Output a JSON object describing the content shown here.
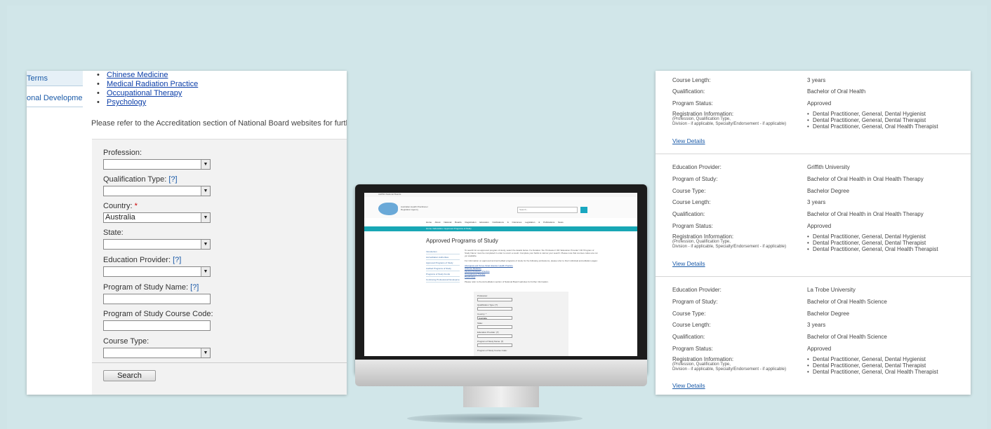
{
  "left_panel": {
    "sidebar": [
      "Terms",
      "onal Development"
    ],
    "profession_links": [
      "Chinese Medicine",
      "Medical Radiation Practice",
      "Occupational Therapy",
      "Psychology"
    ],
    "note": "Please refer to the Accreditation section of National Board websites for further info",
    "form": {
      "profession": "Profession:",
      "qualification_type": "Qualification Type:",
      "help": "[?]",
      "country": "Country:",
      "required": "*",
      "country_value": "Australia",
      "state": "State:",
      "education_provider": "Education Provider:",
      "program_name": "Program of Study Name:",
      "course_code": "Program of Study Course Code:",
      "course_type": "Course Type:",
      "search_button": "Search"
    }
  },
  "monitor": {
    "top_links": "AHPRA   National Boards",
    "logo_text": [
      "Australian Health Practitioner",
      "Regulation Agency"
    ],
    "search_placeholder": "Search...",
    "nav": "Home  About  National Boards  Registration  Education  Notifications & Outcomes  Legislation & Publications  News",
    "breadcrumb": "Home / Education / Approved Programs of Study",
    "page_title": "Approved Programs of Study",
    "side_nav": [
      "Introduction",
      "Accreditation Authorities",
      "Approved Programs of Study",
      "Audited Programs of Study",
      "Programs of Study Funds",
      "Continuing Professional Development"
    ],
    "intro_1": "To search for an approved program of study, select the details below. If a Notation 'the 'Profession' OR 'Education Provider' OR 'Program of Study Name' must be completed in order to return a result. Complete your fields to narrow your search. Please note that courses codes are not yet available.",
    "intro_2": "For information on approved and accredited programs of study for the following professions, please refer to their individual accreditation pages:",
    "links": [
      "Aboriginal and Torres Strait Islander Health Practice",
      "Chinese Medicine",
      "Medical Radiation Practice",
      "Occupational Therapy",
      "Psychology"
    ],
    "note": "Please refer to the Accreditation section of National Board websites for further information.",
    "form_labels": [
      "Profession:",
      "Qualification Type: [?]",
      "Country: *",
      "Australia",
      "State:",
      "Education Provider: [?]",
      "Program of Study Name: [?]",
      "Program of Study Course Code:"
    ]
  },
  "right_panel": {
    "labels": {
      "education_provider": "Education Provider:",
      "program_of_study": "Program of Study:",
      "course_type": "Course Type:",
      "course_length": "Course Length:",
      "qualification": "Qualification:",
      "program_status": "Program Status:",
      "registration_info": "Registration Information:",
      "registration_sub_1": "(Profession, Qualification Type,",
      "registration_sub_2": "Division - if applicable, Specialty/Endorsement - if applicable)",
      "view_details": "View Details"
    },
    "registrations": [
      "Dental Practitioner, General, Dental Hygienist",
      "Dental Practitioner, General, Dental Therapist",
      "Dental Practitioner, General, Oral Health Therapist"
    ],
    "partial_record": {
      "course_length": "3 years",
      "qualification": "Bachelor of Oral Health",
      "program_status": "Approved"
    },
    "records": [
      {
        "education_provider": "Griffith University",
        "program_of_study": "Bachelor of Oral Health in Oral Health Therapy",
        "course_type": "Bachelor Degree",
        "course_length": "3 years",
        "qualification": "Bachelor of Oral Health in Oral Health Therapy",
        "program_status": "Approved"
      },
      {
        "education_provider": "La Trobe University",
        "program_of_study": "Bachelor of Oral Health Science",
        "course_type": "Bachelor Degree",
        "course_length": "3 years",
        "qualification": "Bachelor of Oral Health Science",
        "program_status": "Approved"
      }
    ]
  }
}
